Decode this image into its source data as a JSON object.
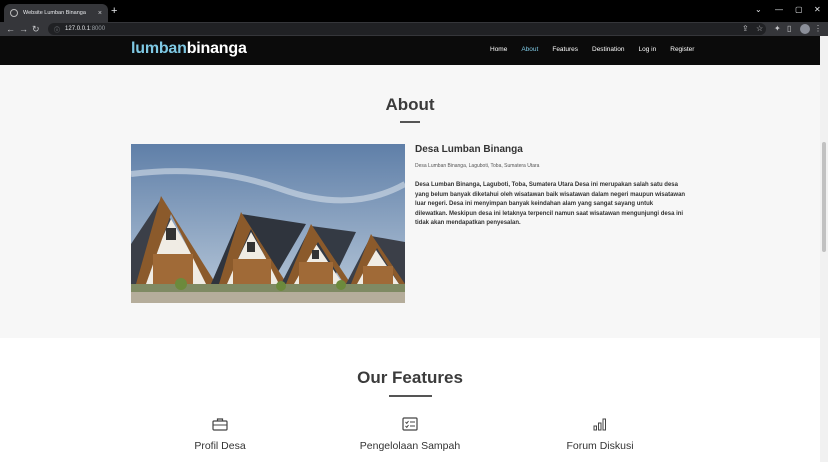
{
  "browser": {
    "tab_title": "Website Lumban Binanga",
    "tab_close": "×",
    "new_tab": "+",
    "url_host": "127.0.0.1",
    "url_port": ":8000",
    "window_controls": [
      "⌄",
      "—",
      "▢",
      "✕"
    ]
  },
  "site": {
    "logo_part1": "lumban",
    "logo_part2": "binanga",
    "nav": [
      {
        "label": "Home"
      },
      {
        "label": "About"
      },
      {
        "label": "Features"
      },
      {
        "label": "Destination"
      },
      {
        "label": "Log in"
      },
      {
        "label": "Register"
      }
    ],
    "active_nav": "About"
  },
  "about": {
    "heading": "About",
    "title": "Desa Lumban Binanga",
    "subtitle": "Desa Lumban Binanga, Laguboti, Toba, Sumatera Utara",
    "description": "Desa Lumban Binanga, Laguboti, Toba, Sumatera Utara Desa ini merupakan salah satu desa yang belum banyak diketahui oleh wisatawan baik wisatawan dalam negeri maupun wisatawan luar negeri. Desa ini menyimpan banyak keindahan alam yang sangat sayang untuk dilewatkan. Meskipun desa ini letaknya terpencil namun saat wisatawan mengunjungi desa ini tidak akan mendapatkan penyesalan."
  },
  "features": {
    "heading": "Our Features",
    "items": [
      {
        "label": "Profil Desa",
        "icon": "briefcase-icon"
      },
      {
        "label": "Pengelolaan Sampah",
        "icon": "checklist-icon"
      },
      {
        "label": "Forum Diskusi",
        "icon": "bar-chart-icon"
      }
    ]
  },
  "colors": {
    "accent": "#7ec8e3",
    "nav_bg": "#0b0b0b",
    "about_bg": "#f7f7f7"
  }
}
